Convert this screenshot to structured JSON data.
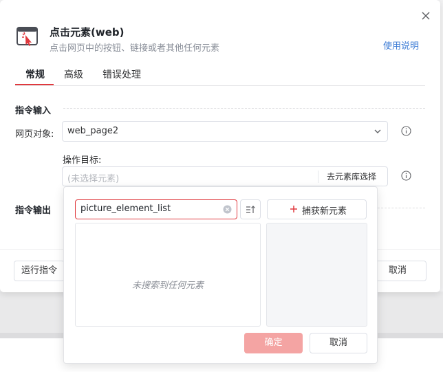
{
  "dialog": {
    "title": "点击元素(web)",
    "subtitle": "点击网页中的按钮、链接或者其他任何元素",
    "help_link": "使用说明"
  },
  "tabs": [
    {
      "label": "常规",
      "active": true
    },
    {
      "label": "高级",
      "active": false
    },
    {
      "label": "错误处理",
      "active": false
    }
  ],
  "sections": {
    "input_title": "指令输入",
    "output_title": "指令输出"
  },
  "fields": {
    "web_object_label": "网页对象:",
    "web_object_value": "web_page2",
    "target_label": "操作目标:",
    "target_placeholder": "(未选择元素)",
    "library_button": "去元素库选择"
  },
  "footer": {
    "run_button": "运行指令",
    "cancel_button": "取消"
  },
  "element_picker": {
    "search_value": "picture_element_list",
    "capture_button": "捕获新元素",
    "empty_text": "未搜索到任何元素",
    "confirm_button": "确定",
    "cancel_button": "取消"
  },
  "colors": {
    "accent": "#e0393e",
    "link": "#3a7ad5",
    "confirm_disabled": "#f4a4a3"
  },
  "icons": {
    "app": "cursor-click-window-icon",
    "close": "close-icon",
    "info": "info-icon",
    "chevron": "chevron-down-icon",
    "clear": "clear-icon",
    "sort": "sort-icon",
    "plus": "plus-icon"
  }
}
